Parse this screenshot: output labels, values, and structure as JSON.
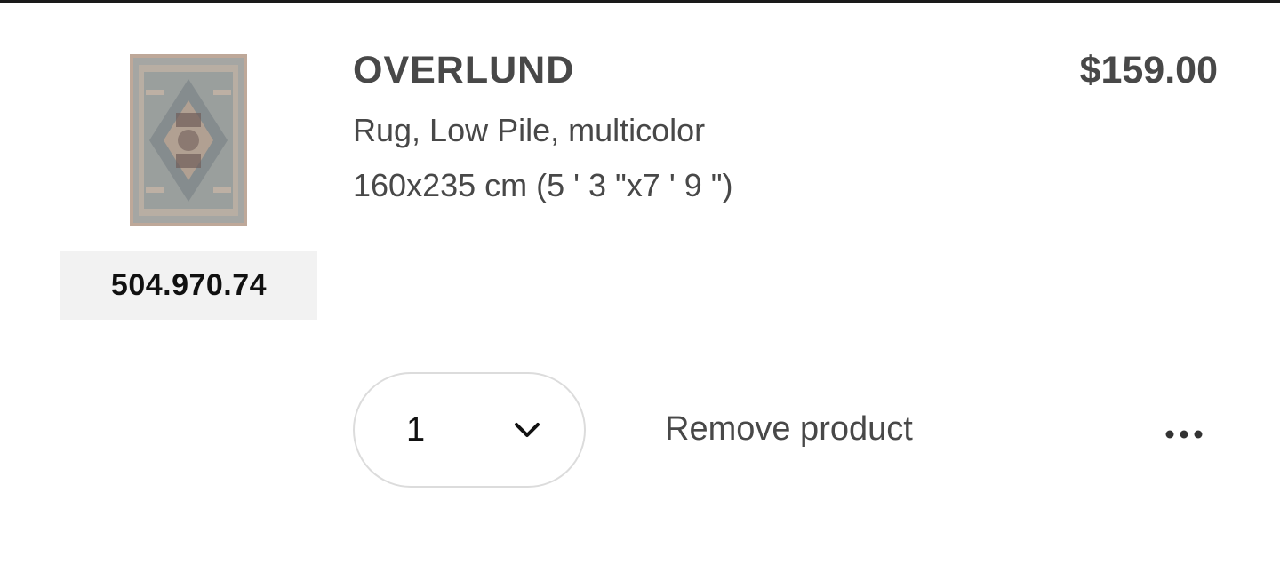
{
  "product": {
    "name": "OVERLUND",
    "description": "Rug, Low Pile, multicolor",
    "size": "160x235 cm (5 ' 3 \"x7 ' 9 \")",
    "price": "$159.00",
    "article_number": "504.970.74",
    "image_icon": "rug-product-image"
  },
  "quantity": {
    "value": "1",
    "icon": "chevron-down-icon"
  },
  "actions": {
    "remove_label": "Remove product",
    "more_icon": "more-options-icon"
  },
  "colors": {
    "text": "#484848",
    "strong_text": "#111111",
    "article_bg": "#f2f2f2",
    "border": "#dcdcdc"
  }
}
